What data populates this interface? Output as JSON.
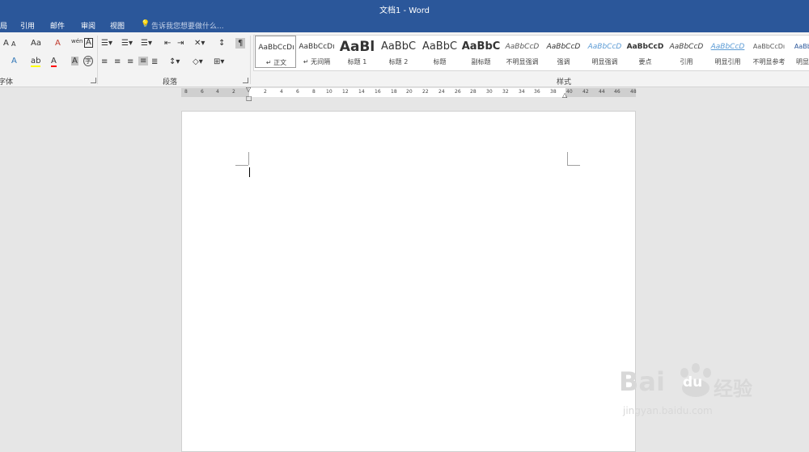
{
  "window": {
    "title": "文档1 - Word"
  },
  "menu": {
    "items": [
      "局",
      "引用",
      "邮件",
      "审阅",
      "视图"
    ],
    "tell_me": "告诉我您想要做什么..."
  },
  "ribbon": {
    "groups": {
      "font": "字体",
      "paragraph": "段落",
      "styles": "样式"
    },
    "font_tools": {
      "grow": "A",
      "shrink": "A",
      "case": "Aa",
      "clear": "A",
      "phonetic": "wén",
      "border": "A",
      "text_effect": "A",
      "highlight": "ab",
      "font_color": "A",
      "shading": "A",
      "enclose": "字"
    },
    "styles": [
      {
        "sample": "AaBbCcDı",
        "name": "正文",
        "prefix": "↵"
      },
      {
        "sample": "AaBbCcDı",
        "name": "无间隔",
        "prefix": "↵"
      },
      {
        "sample": "AaBl",
        "name": "标题 1"
      },
      {
        "sample": "AaBbC",
        "name": "标题 2"
      },
      {
        "sample": "AaBbC",
        "name": "标题"
      },
      {
        "sample": "AaBbC",
        "name": "副标题"
      },
      {
        "sample": "AaBbCcD",
        "name": "不明显强调"
      },
      {
        "sample": "AaBbCcD",
        "name": "强调"
      },
      {
        "sample": "AaBbCcD",
        "name": "明显强调"
      },
      {
        "sample": "AaBbCcD",
        "name": "要点"
      },
      {
        "sample": "AaBbCcD",
        "name": "引用"
      },
      {
        "sample": "AaBbCcD",
        "name": "明显引用"
      },
      {
        "sample": "AaBbCcDı",
        "name": "不明显参考"
      },
      {
        "sample": "AaBbCcDı",
        "name": "明显参考"
      }
    ]
  },
  "ruler": {
    "left_ticks": [
      "8",
      "6",
      "4",
      "2"
    ],
    "ticks": [
      "2",
      "4",
      "6",
      "8",
      "10",
      "12",
      "14",
      "16",
      "18",
      "20",
      "22",
      "24",
      "26",
      "28",
      "30",
      "32",
      "34",
      "36",
      "38",
      "40",
      "42",
      "44",
      "46",
      "48"
    ]
  },
  "watermark": {
    "brand": "Bai",
    "brand2": "du",
    "cn": "经验",
    "url": "jingyan.baidu.com"
  },
  "colors": {
    "accent": "#2b579a",
    "ribbon": "#f3f3f3",
    "canvas": "#e6e6e6",
    "page": "#ffffff"
  }
}
